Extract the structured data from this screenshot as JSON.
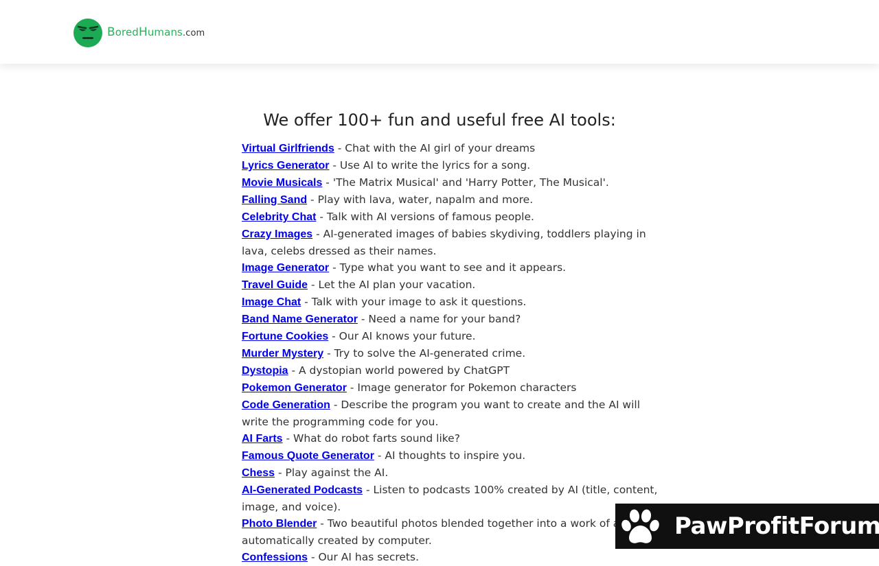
{
  "header": {
    "logo": {
      "word1_initial": "B",
      "word1_rest": "ored",
      "word2_initial": "H",
      "word2_rest": "umans",
      "domain": ".com",
      "brand_color": "#2bb15a"
    }
  },
  "main": {
    "heading": "We offer 100+ fun and useful free AI tools:",
    "tools": [
      {
        "name": "Virtual Girlfriends",
        "desc": " - Chat with the AI girl of your dreams"
      },
      {
        "name": "Lyrics Generator",
        "desc": " - Use AI to write the lyrics for a song."
      },
      {
        "name": "Movie Musicals",
        "desc": " - 'The Matrix Musical' and 'Harry Potter, The Musical'."
      },
      {
        "name": "Falling Sand",
        "desc": " - Play with lava, water, napalm and more."
      },
      {
        "name": "Celebrity Chat",
        "desc": " - Talk with AI versions of famous people."
      },
      {
        "name": "Crazy Images",
        "desc": " - AI-generated images of babies skydiving, toddlers playing in lava, celebs dressed as their names."
      },
      {
        "name": "Image Generator",
        "desc": " - Type what you want to see and it appears."
      },
      {
        "name": "Travel Guide",
        "desc": " - Let the AI plan your vacation."
      },
      {
        "name": "Image Chat",
        "desc": " - Talk with your image to ask it questions."
      },
      {
        "name": "Band Name Generator",
        "desc": " - Need a name for your band?"
      },
      {
        "name": "Fortune Cookies",
        "desc": " - Our AI knows your future."
      },
      {
        "name": "Murder Mystery",
        "desc": " - Try to solve the AI-generated crime."
      },
      {
        "name": "Dystopia",
        "desc": " - A dystopian world powered by ChatGPT"
      },
      {
        "name": "Pokemon Generator",
        "desc": " - Image generator for Pokemon characters"
      },
      {
        "name": "Code Generation",
        "desc": " - Describe the program you want to create and the AI will write the programming code for you."
      },
      {
        "name": "AI Farts",
        "desc": " - What do robot farts sound like?"
      },
      {
        "name": "Famous Quote Generator",
        "desc": " - AI thoughts to inspire you."
      },
      {
        "name": "Chess",
        "desc": " - Play against the AI."
      },
      {
        "name": "AI-Generated Podcasts",
        "desc": " - Listen to podcasts 100% created by AI (title, content, image, and voice)."
      },
      {
        "name": "Photo Blender",
        "desc": " - Two beautiful photos blended together into a work of art automatically created by computer."
      },
      {
        "name": "Confessions",
        "desc": " - Our AI has secrets."
      }
    ],
    "link_color": "#0000ee"
  },
  "watermark": {
    "text": "PawProfitForum",
    "icon": "paw-icon"
  }
}
